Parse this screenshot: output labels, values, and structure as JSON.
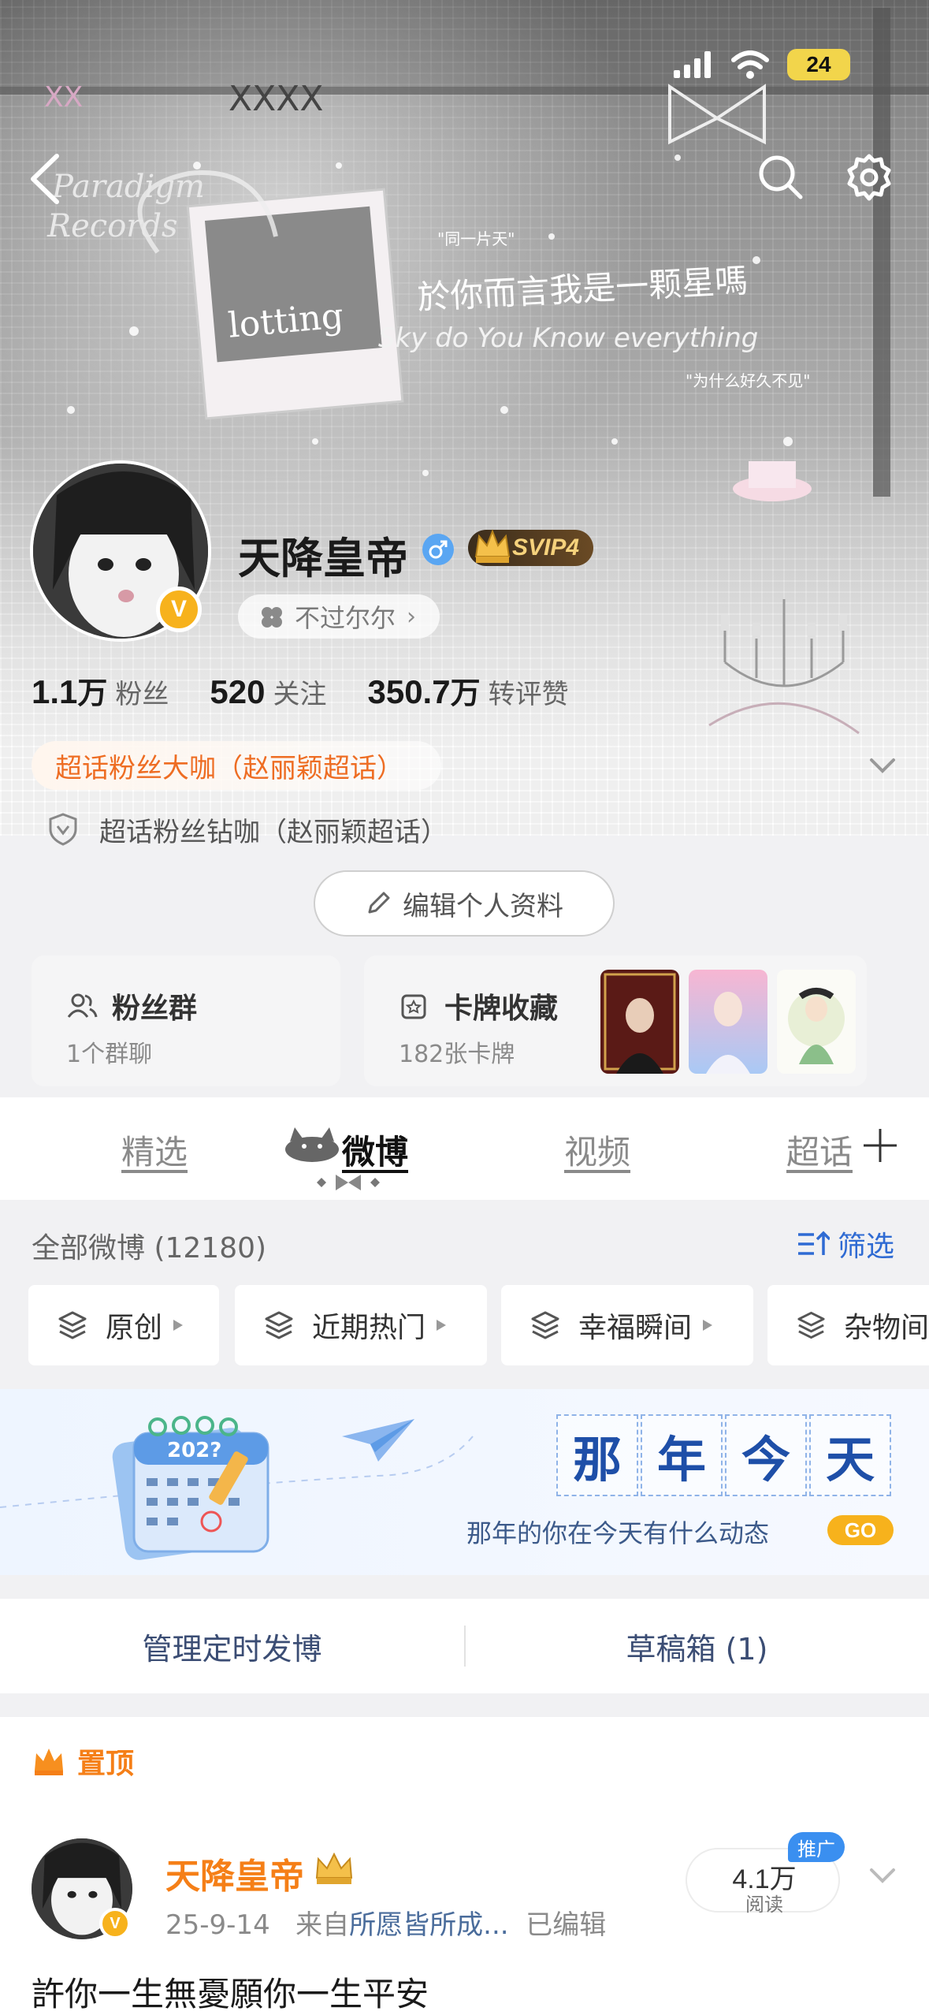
{
  "status_bar": {
    "battery": "24"
  },
  "header_art": {
    "texts": [
      "Paradigm",
      "Records",
      "lotting",
      "\"同一片天\"",
      "於你而言我是一颗星嗎",
      "Sky do You Know everything",
      "\"为什么好久不见\""
    ]
  },
  "profile": {
    "username": "天降皇帝",
    "verified_mark": "V",
    "vip_badge": "SVIP4",
    "mood": "不过尔尔",
    "stats": [
      {
        "num": "1.1",
        "unit": "万",
        "label": "粉丝"
      },
      {
        "num": "520",
        "unit": "",
        "label": "关注"
      },
      {
        "num": "350.7",
        "unit": "万",
        "label": "转评赞"
      }
    ],
    "badge_primary": "超话粉丝大咖（赵丽颖超话）",
    "badge_secondary": "超话粉丝钻咖（赵丽颖超话）",
    "edit_label": "编辑个人资料"
  },
  "cards": {
    "fans": {
      "title": "粉丝群",
      "sub": "1个群聊"
    },
    "collection": {
      "title": "卡牌收藏",
      "sub": "182张卡牌"
    }
  },
  "tabs": [
    "精选",
    "微博",
    "视频",
    "超话"
  ],
  "active_tab": "微博",
  "feed": {
    "count_label": "全部微博 (12180)",
    "filter_label": "筛选",
    "chips": [
      "原创",
      "近期热门",
      "幸福瞬间",
      "杂物间"
    ]
  },
  "banner": {
    "title_chars": [
      "那",
      "年",
      "今",
      "天"
    ],
    "year": "202?",
    "subtitle": "那年的你在今天有什么动态",
    "go": "GO"
  },
  "manage": {
    "scheduled": "管理定时发博",
    "drafts": "草稿箱 (1)"
  },
  "post": {
    "pinned": "置顶",
    "name": "天降皇帝",
    "date": "25-9-14",
    "source_prefix": "来自",
    "source": "所愿皆所成...",
    "edited": "已编辑",
    "reads": "4.1万",
    "reads_label": "阅读",
    "promo": "推广",
    "text": "許你一生無憂願你一生平安"
  },
  "colors": {
    "accent_orange": "#f57f17",
    "link_blue": "#2f6bd3",
    "gold": "#f7b21c"
  }
}
